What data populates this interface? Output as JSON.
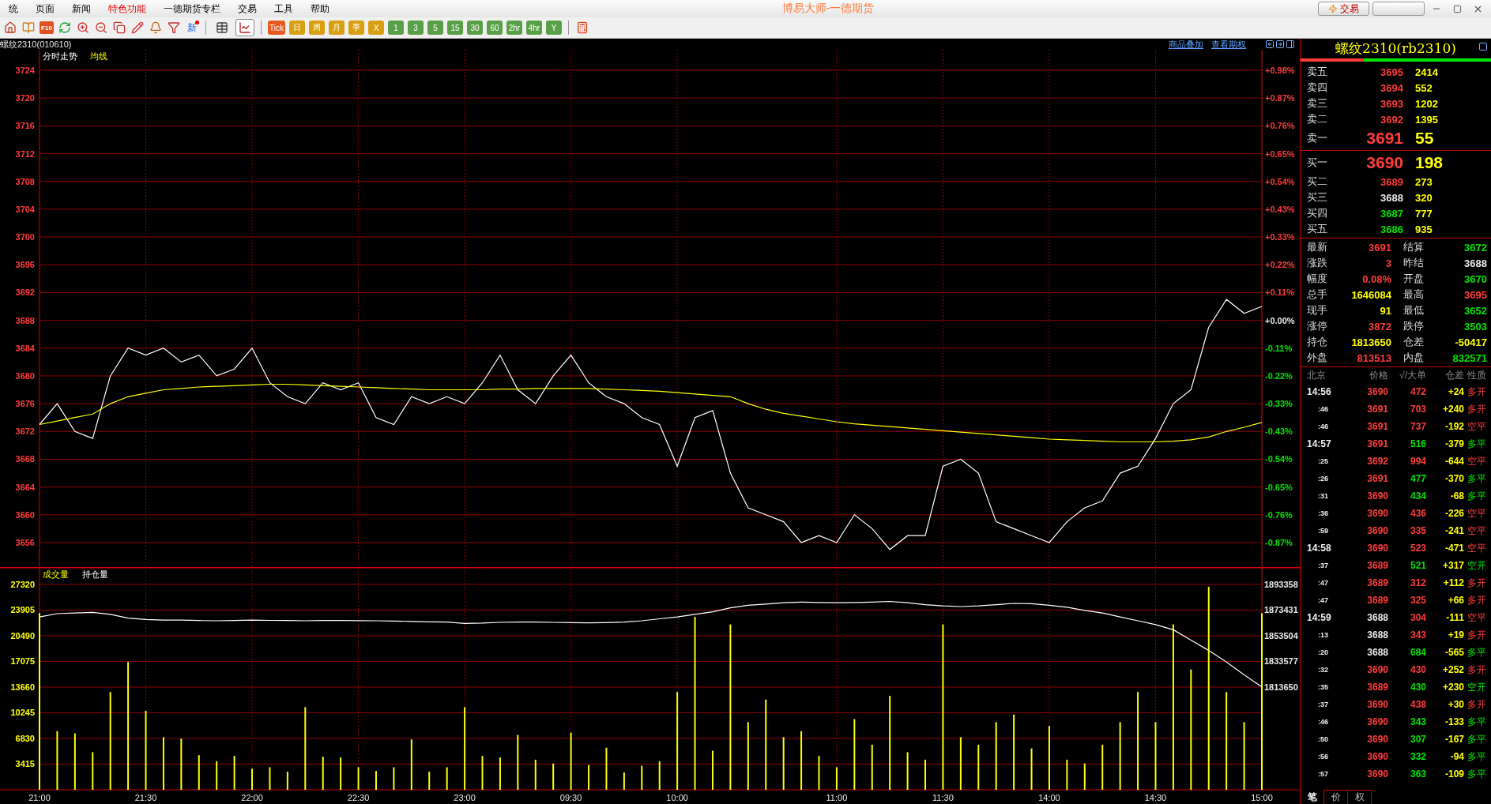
{
  "menu": [
    {
      "label": "统",
      "highlighted": false
    },
    {
      "label": "页面",
      "highlighted": false
    },
    {
      "label": "新闻",
      "highlighted": false
    },
    {
      "label": "特色功能",
      "highlighted": true
    },
    {
      "label": "一德期货专栏",
      "highlighted": false
    },
    {
      "label": "交易",
      "highlighted": false
    },
    {
      "label": "工具",
      "highlighted": false
    },
    {
      "label": "帮助",
      "highlighted": false
    }
  ],
  "title": "博易大师-一德期货",
  "trade_button": "交易",
  "toolbar": {
    "f10": "F10",
    "news": "新",
    "views": [
      {
        "selected": false
      },
      {
        "selected": true
      }
    ],
    "periods": [
      {
        "label": "Tick",
        "kind": "tick"
      },
      {
        "label": "日",
        "kind": "day"
      },
      {
        "label": "周",
        "kind": "day"
      },
      {
        "label": "月",
        "kind": "day"
      },
      {
        "label": "季",
        "kind": "day"
      },
      {
        "label": "X",
        "kind": "day"
      },
      {
        "label": "1",
        "kind": "minute"
      },
      {
        "label": "3",
        "kind": "minute"
      },
      {
        "label": "5",
        "kind": "minute"
      },
      {
        "label": "15",
        "kind": "minute"
      },
      {
        "label": "30",
        "kind": "minute"
      },
      {
        "label": "60",
        "kind": "minute"
      },
      {
        "label": "2hr",
        "kind": "minute"
      },
      {
        "label": "4hr",
        "kind": "minute"
      },
      {
        "label": "Y",
        "kind": "minute"
      }
    ]
  },
  "chart_header": {
    "symbol": "螺纹2310(010610)",
    "links": [
      "商品叠加",
      "查看期权"
    ]
  },
  "price_chart": {
    "percent_labels": [
      {
        "label": "+0.98%",
        "color": "#ff3c3c"
      },
      {
        "label": "+0.87%",
        "color": "#ff3c3c"
      },
      {
        "label": "+0.76%",
        "color": "#ff3c3c"
      },
      {
        "label": "+0.65%",
        "color": "#ff3c3c"
      },
      {
        "label": "+0.54%",
        "color": "#ff3c3c"
      },
      {
        "label": "+0.43%",
        "color": "#ff3c3c"
      },
      {
        "label": "+0.33%",
        "color": "#ff3c3c"
      },
      {
        "label": "+0.22%",
        "color": "#ff3c3c"
      },
      {
        "label": "+0.11%",
        "color": "#ff3c3c"
      },
      {
        "label": "+0.00%",
        "color": "#e8e8e8"
      },
      {
        "label": "-0.11%",
        "color": "#00e600"
      },
      {
        "label": "-0.22%",
        "color": "#00e600"
      },
      {
        "label": "-0.33%",
        "color": "#00e600"
      },
      {
        "label": "-0.43%",
        "color": "#00e600"
      },
      {
        "label": "-0.54%",
        "color": "#00e600"
      },
      {
        "label": "-0.65%",
        "color": "#00e600"
      },
      {
        "label": "-0.76%",
        "color": "#00e600"
      },
      {
        "label": "-0.87%",
        "color": "#00e600"
      }
    ],
    "chart_data": {
      "type": "line",
      "grid": true,
      "ylim": [
        3652.36,
        3726.96
      ],
      "yticks": [
        3724,
        3720,
        3716,
        3712,
        3708,
        3704,
        3700,
        3696,
        3692,
        3688,
        3684,
        3680,
        3676,
        3672,
        3668,
        3664,
        3660,
        3656
      ],
      "series": [
        {
          "name": "分时走势",
          "color": "#ffffff",
          "values": [
            3673,
            3676,
            3672,
            3671,
            3680,
            3684,
            3683,
            3684,
            3682,
            3683,
            3680,
            3681,
            3684,
            3679,
            3677,
            3676,
            3679,
            3678,
            3679,
            3674,
            3673,
            3677,
            3676,
            3677,
            3676,
            3679,
            3683,
            3678,
            3676,
            3680,
            3683,
            3679,
            3677,
            3676,
            3674,
            3673,
            3667,
            3674,
            3675,
            3666,
            3661,
            3660,
            3659,
            3656,
            3657,
            3656,
            3660,
            3658,
            3655,
            3657,
            3657,
            3667,
            3668,
            3666,
            3659,
            3658,
            3657,
            3656,
            3659,
            3661,
            3662,
            3666,
            3667,
            3671,
            3676,
            3678,
            3687,
            3691,
            3689,
            3690
          ]
        },
        {
          "name": "均线",
          "color": "#ffff00",
          "values": [
            3673,
            3673.5,
            3674,
            3674.5,
            3676,
            3677,
            3677.5,
            3678,
            3678.2,
            3678.4,
            3678.5,
            3678.6,
            3678.7,
            3678.8,
            3678.8,
            3678.7,
            3678.6,
            3678.5,
            3678.4,
            3678.3,
            3678.2,
            3678.1,
            3678,
            3678,
            3678,
            3678,
            3678.1,
            3678.1,
            3678.2,
            3678.2,
            3678.2,
            3678.2,
            3678.1,
            3678,
            3677.9,
            3677.8,
            3677.6,
            3677.4,
            3677.2,
            3677,
            3676,
            3675.2,
            3674.6,
            3674.2,
            3673.8,
            3673.4,
            3673.1,
            3672.9,
            3672.7,
            3672.5,
            3672.3,
            3672.1,
            3671.9,
            3671.7,
            3671.5,
            3671.3,
            3671.1,
            3670.9,
            3670.8,
            3670.7,
            3670.6,
            3670.5,
            3670.5,
            3670.5,
            3670.6,
            3670.8,
            3671.2,
            3672,
            3672.6,
            3673.3
          ]
        }
      ]
    }
  },
  "volume_chart": {
    "chart_data": {
      "type": "bar",
      "stacked": false,
      "grid": true,
      "ylim": [
        0,
        29630
      ],
      "y2lim": [
        1733944,
        1906642
      ],
      "yticks": [
        27320,
        23905,
        20490,
        17075,
        13660,
        10245,
        6830,
        3415
      ],
      "y2ticks": [
        1893358,
        1873431,
        1853504,
        1833577,
        1813650
      ],
      "categories": [
        "21:00",
        null,
        null,
        null,
        null,
        null,
        "21:30",
        null,
        null,
        null,
        null,
        null,
        "22:00",
        null,
        null,
        null,
        null,
        null,
        "22:30",
        null,
        null,
        null,
        null,
        null,
        "23:00",
        null,
        null,
        null,
        null,
        null,
        "09:30",
        null,
        null,
        null,
        null,
        null,
        "10:00",
        null,
        null,
        null,
        null,
        null,
        null,
        null,
        null,
        "11:00",
        null,
        null,
        null,
        null,
        null,
        "11:30",
        null,
        null,
        null,
        null,
        null,
        "14:00",
        null,
        null,
        null,
        null,
        null,
        "14:30",
        null,
        null,
        null,
        null,
        null,
        "15:00"
      ],
      "series": [
        {
          "name": "成交量",
          "color": "#ffff00",
          "values": [
            23500,
            7800,
            7500,
            5000,
            13000,
            17000,
            10500,
            7000,
            6800,
            4600,
            3800,
            4500,
            2800,
            3000,
            2400,
            11000,
            4400,
            4300,
            3000,
            2500,
            3000,
            6700,
            2400,
            3000,
            11000,
            4500,
            4300,
            7300,
            4000,
            3500,
            7600,
            3300,
            5600,
            2300,
            3200,
            3800,
            13000,
            23000,
            5200,
            22000,
            9000,
            12000,
            7000,
            7800,
            4500,
            3000,
            9400,
            6000,
            12500,
            5000,
            4000,
            22000,
            7000,
            6000,
            9000,
            10000,
            5500,
            8500,
            4000,
            3500,
            6000,
            9000,
            13000,
            9000,
            22000,
            16000,
            27000,
            13000,
            9000,
            23500
          ]
        },
        {
          "name": "持仓量",
          "color": "#ffffff",
          "type": "line",
          "axis": "y2",
          "values": [
            1868000,
            1870500,
            1871000,
            1871500,
            1870000,
            1867000,
            1866000,
            1865500,
            1865500,
            1865200,
            1865000,
            1865200,
            1865500,
            1865300,
            1865200,
            1865000,
            1865200,
            1865300,
            1865100,
            1865000,
            1864800,
            1864500,
            1864200,
            1864000,
            1863000,
            1863200,
            1863800,
            1864000,
            1864000,
            1863800,
            1863600,
            1863400,
            1863500,
            1864000,
            1865000,
            1866500,
            1868000,
            1870000,
            1872000,
            1875000,
            1877000,
            1878000,
            1879000,
            1879500,
            1879200,
            1879000,
            1879200,
            1879500,
            1880000,
            1879000,
            1877500,
            1876500,
            1876000,
            1876500,
            1877500,
            1878500,
            1878200,
            1877000,
            1875500,
            1873000,
            1871000,
            1868000,
            1865000,
            1862000,
            1858000,
            1850000,
            1842000,
            1833000,
            1823000,
            1813650
          ]
        }
      ]
    }
  },
  "quote": {
    "title": "螺纹2310(rb2310)",
    "ratio": {
      "level": 0.33
    },
    "asks": [
      {
        "label": "卖五",
        "price": "3695",
        "volume": "2414",
        "color": "#ff3c3c",
        "best": false
      },
      {
        "label": "卖四",
        "price": "3694",
        "volume": "552",
        "color": "#ff3c3c",
        "best": false
      },
      {
        "label": "卖三",
        "price": "3693",
        "volume": "1202",
        "color": "#ff3c3c",
        "best": false
      },
      {
        "label": "卖二",
        "price": "3692",
        "volume": "1395",
        "color": "#ff3c3c",
        "best": false
      },
      {
        "label": "卖一",
        "price": "3691",
        "volume": "55",
        "color": "#ff3c3c",
        "best": true
      }
    ],
    "bids": [
      {
        "label": "买一",
        "price": "3690",
        "volume": "198",
        "color": "#ff3c3c",
        "best": true
      },
      {
        "label": "买二",
        "price": "3689",
        "volume": "273",
        "color": "#ff3c3c",
        "best": false
      },
      {
        "label": "买三",
        "price": "3688",
        "volume": "320",
        "color": "#e8e8e8",
        "best": false
      },
      {
        "label": "买四",
        "price": "3687",
        "volume": "777",
        "color": "#00e600",
        "best": false
      },
      {
        "label": "买五",
        "price": "3686",
        "volume": "935",
        "color": "#00e600",
        "best": false
      }
    ],
    "stats": [
      {
        "label": "最新",
        "value": "3691",
        "color": "#ff3c3c"
      },
      {
        "label": "结算",
        "value": "3672",
        "color": "#00e600"
      },
      {
        "label": "涨跌",
        "value": "3",
        "color": "#ff3c3c"
      },
      {
        "label": "昨结",
        "value": "3688",
        "color": "#e8e8e8"
      },
      {
        "label": "幅度",
        "value": "0.08%",
        "color": "#ff3c3c"
      },
      {
        "label": "开盘",
        "value": "3670",
        "color": "#00e600"
      },
      {
        "label": "总手",
        "value": "1646084",
        "color": "#ffff00"
      },
      {
        "label": "最高",
        "value": "3695",
        "color": "#ff3c3c"
      },
      {
        "label": "现手",
        "value": "91",
        "color": "#ffff00"
      },
      {
        "label": "最低",
        "value": "3652",
        "color": "#00e600"
      },
      {
        "label": "涨停",
        "value": "3872",
        "color": "#ff3c3c"
      },
      {
        "label": "跌停",
        "value": "3503",
        "color": "#00e600"
      },
      {
        "label": "持仓",
        "value": "1813650",
        "color": "#ffff00"
      },
      {
        "label": "仓差",
        "value": "-50417",
        "color": "#ffff00"
      },
      {
        "label": "外盘",
        "value": "813513",
        "color": "#ff3c3c"
      },
      {
        "label": "内盘",
        "value": "832571",
        "color": "#00e600"
      }
    ],
    "ticks": {
      "columns": [
        "北京",
        "价格",
        "√/大单",
        "仓差",
        "性质"
      ],
      "rows": [
        {
          "time": "14:56",
          "kind": "minute",
          "price": {
            "value": "3690",
            "color": "#ff3c3c"
          },
          "volume": "472",
          "diff": "+24",
          "nature": "多开",
          "color": "#ff3c3c"
        },
        {
          "time": ":46",
          "kind": "second",
          "price": {
            "value": "3691",
            "color": "#ff3c3c"
          },
          "volume": "703",
          "diff": "+240",
          "nature": "多开",
          "color": "#ff3c3c"
        },
        {
          "time": ":46",
          "kind": "second",
          "price": {
            "value": "3691",
            "color": "#ff3c3c"
          },
          "volume": "737",
          "diff": "-192",
          "nature": "空平",
          "color": "#ff3c3c"
        },
        {
          "time": "14:57",
          "kind": "minute",
          "price": {
            "value": "3691",
            "color": "#ff3c3c"
          },
          "volume": "516",
          "diff": "-379",
          "nature": "多平",
          "color": "#00e600"
        },
        {
          "time": ":25",
          "kind": "second",
          "price": {
            "value": "3692",
            "color": "#ff3c3c"
          },
          "volume": "994",
          "diff": "-644",
          "nature": "空平",
          "color": "#ff3c3c"
        },
        {
          "time": ":26",
          "kind": "second",
          "price": {
            "value": "3691",
            "color": "#ff3c3c"
          },
          "volume": "477",
          "diff": "-370",
          "nature": "多平",
          "color": "#00e600"
        },
        {
          "time": ":31",
          "kind": "second",
          "price": {
            "value": "3690",
            "color": "#ff3c3c"
          },
          "volume": "434",
          "diff": "-68",
          "nature": "多平",
          "color": "#00e600"
        },
        {
          "time": ":36",
          "kind": "second",
          "price": {
            "value": "3690",
            "color": "#ff3c3c"
          },
          "volume": "436",
          "diff": "-226",
          "nature": "空平",
          "color": "#ff3c3c"
        },
        {
          "time": ":59",
          "kind": "second",
          "price": {
            "value": "3690",
            "color": "#ff3c3c"
          },
          "volume": "335",
          "diff": "-241",
          "nature": "空平",
          "color": "#ff3c3c"
        },
        {
          "time": "14:58",
          "kind": "minute",
          "price": {
            "value": "3690",
            "color": "#ff3c3c"
          },
          "volume": "523",
          "diff": "-471",
          "nature": "空平",
          "color": "#ff3c3c"
        },
        {
          "time": ":37",
          "kind": "second",
          "price": {
            "value": "3689",
            "color": "#ff3c3c"
          },
          "volume": "521",
          "diff": "+317",
          "nature": "空开",
          "color": "#00e600"
        },
        {
          "time": ":47",
          "kind": "second",
          "price": {
            "value": "3689",
            "color": "#ff3c3c"
          },
          "volume": "312",
          "diff": "+112",
          "nature": "多开",
          "color": "#ff3c3c"
        },
        {
          "time": ":47",
          "kind": "second",
          "price": {
            "value": "3689",
            "color": "#ff3c3c"
          },
          "volume": "325",
          "diff": "+66",
          "nature": "多开",
          "color": "#ff3c3c"
        },
        {
          "time": "14:59",
          "kind": "minute",
          "price": {
            "value": "3688",
            "color": "#e8e8e8"
          },
          "volume": "304",
          "diff": "-111",
          "nature": "空平",
          "color": "#ff3c3c"
        },
        {
          "time": ":13",
          "kind": "second",
          "price": {
            "value": "3688",
            "color": "#e8e8e8"
          },
          "volume": "343",
          "diff": "+19",
          "nature": "多开",
          "color": "#ff3c3c"
        },
        {
          "time": ":20",
          "kind": "second",
          "price": {
            "value": "3688",
            "color": "#e8e8e8"
          },
          "volume": "684",
          "diff": "-565",
          "nature": "多平",
          "color": "#00e600"
        },
        {
          "time": ":32",
          "kind": "second",
          "price": {
            "value": "3690",
            "color": "#ff3c3c"
          },
          "volume": "430",
          "diff": "+252",
          "nature": "多开",
          "color": "#ff3c3c"
        },
        {
          "time": ":35",
          "kind": "second",
          "price": {
            "value": "3689",
            "color": "#ff3c3c"
          },
          "volume": "430",
          "diff": "+230",
          "nature": "空开",
          "color": "#00e600"
        },
        {
          "time": ":37",
          "kind": "second",
          "price": {
            "value": "3690",
            "color": "#ff3c3c"
          },
          "volume": "438",
          "diff": "+30",
          "nature": "多开",
          "color": "#ff3c3c"
        },
        {
          "time": ":46",
          "kind": "second",
          "price": {
            "value": "3690",
            "color": "#ff3c3c"
          },
          "volume": "343",
          "diff": "-133",
          "nature": "多平",
          "color": "#00e600"
        },
        {
          "time": ":50",
          "kind": "second",
          "price": {
            "value": "3690",
            "color": "#ff3c3c"
          },
          "volume": "307",
          "diff": "-167",
          "nature": "多平",
          "color": "#00e600"
        },
        {
          "time": ":56",
          "kind": "second",
          "price": {
            "value": "3690",
            "color": "#ff3c3c"
          },
          "volume": "332",
          "diff": "-94",
          "nature": "多平",
          "color": "#00e600"
        },
        {
          "time": ":57",
          "kind": "second",
          "price": {
            "value": "3690",
            "color": "#ff3c3c"
          },
          "volume": "363",
          "diff": "-109",
          "nature": "多平",
          "color": "#00e600"
        }
      ]
    },
    "tabs": [
      {
        "label": "笔",
        "selected": true
      },
      {
        "label": "价",
        "selected": false
      },
      {
        "label": "权",
        "selected": false
      }
    ]
  }
}
